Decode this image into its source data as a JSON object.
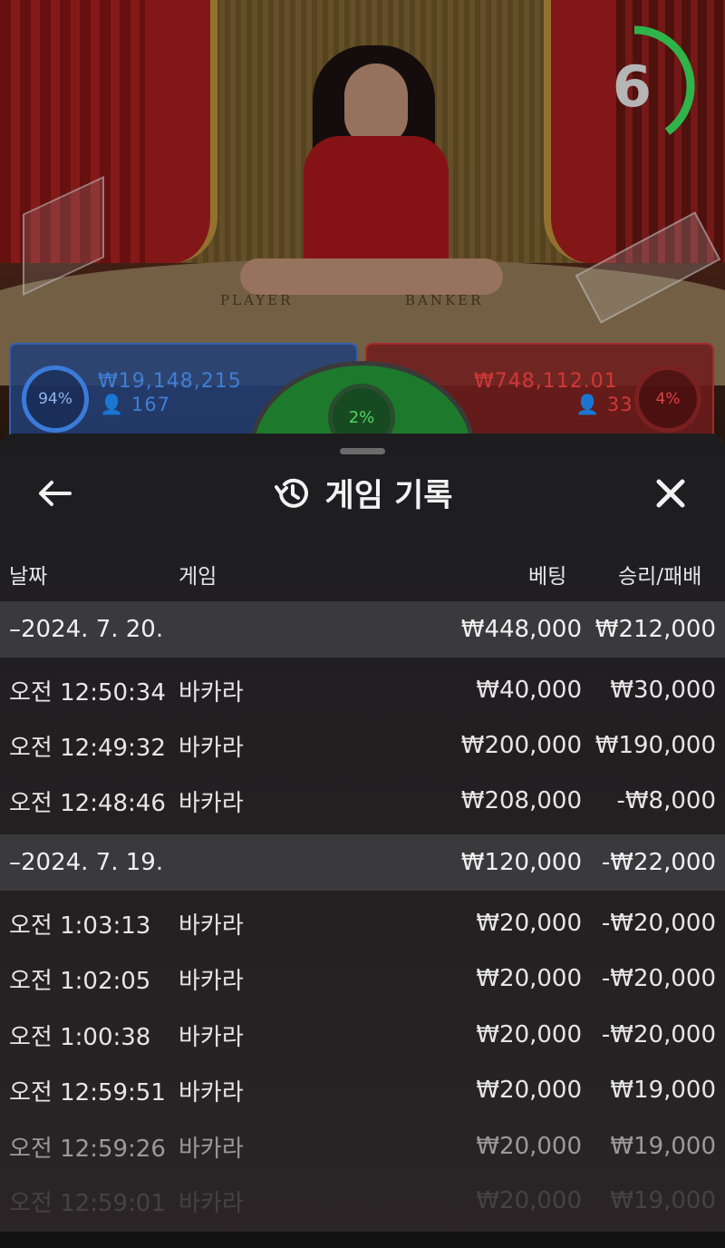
{
  "video": {
    "timer": "6",
    "timer_progress": 0.4,
    "table_labels": {
      "player": "PLAYER",
      "banker": "BANKER"
    }
  },
  "bets": {
    "player": {
      "percent": "94%",
      "amount": "₩19,148,215",
      "players": "167"
    },
    "banker": {
      "percent": "4%",
      "amount": "₩748,112.01",
      "players": "33"
    },
    "tie": {
      "percent": "2%"
    }
  },
  "history": {
    "title": "게임 기록",
    "icons": {
      "back": "arrow-left-icon",
      "history": "history-icon",
      "close": "close-icon"
    },
    "columns": {
      "date": "날짜",
      "game": "게임",
      "bet": "베팅",
      "result": "승리/패배"
    },
    "groups": [
      {
        "date": "–2024. 7. 20.",
        "bet_total": "₩448,000",
        "result_total": "₩212,000",
        "rows": [
          {
            "time": "오전 12:50:34",
            "game": "바카라",
            "bet": "₩40,000",
            "result": "₩30,000"
          },
          {
            "time": "오전 12:49:32",
            "game": "바카라",
            "bet": "₩200,000",
            "result": "₩190,000"
          },
          {
            "time": "오전 12:48:46",
            "game": "바카라",
            "bet": "₩208,000",
            "result": "-₩8,000"
          }
        ]
      },
      {
        "date": "–2024. 7. 19.",
        "bet_total": "₩120,000",
        "result_total": "-₩22,000",
        "rows": [
          {
            "time": "오전 1:03:13",
            "game": "바카라",
            "bet": "₩20,000",
            "result": "-₩20,000"
          },
          {
            "time": "오전 1:02:05",
            "game": "바카라",
            "bet": "₩20,000",
            "result": "-₩20,000"
          },
          {
            "time": "오전 1:00:38",
            "game": "바카라",
            "bet": "₩20,000",
            "result": "-₩20,000"
          },
          {
            "time": "오전 12:59:51",
            "game": "바카라",
            "bet": "₩20,000",
            "result": "₩19,000"
          },
          {
            "time": "오전 12:59:26",
            "game": "바카라",
            "bet": "₩20,000",
            "result": "₩19,000"
          },
          {
            "time": "오전 12:59:01",
            "game": "바카라",
            "bet": "₩20,000",
            "result": "₩19,000"
          }
        ]
      }
    ]
  },
  "colors": {
    "player": "#3f7fd6",
    "banker": "#d33737",
    "tie": "#4fd45f",
    "timer_ring": "#2fb44a"
  }
}
